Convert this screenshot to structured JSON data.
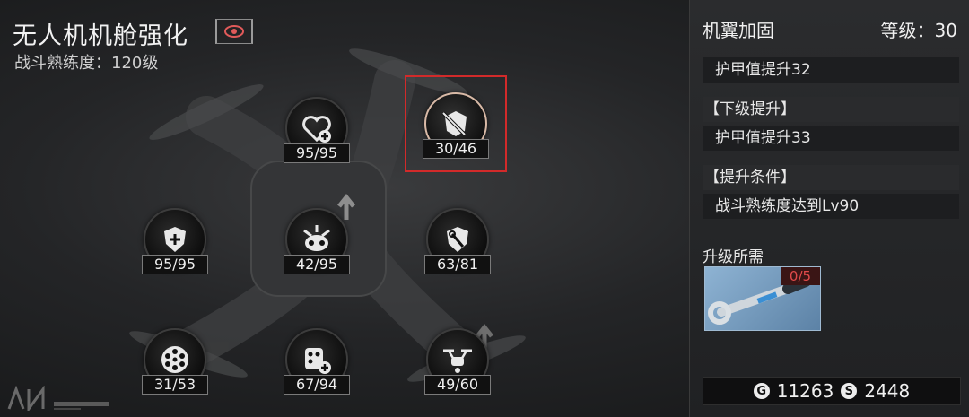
{
  "header": {
    "title": "无人机机舱强化",
    "subtitle": "战斗熟练度：120级"
  },
  "nodes": [
    {
      "name": "heart-plus",
      "count": "95/95"
    },
    {
      "name": "wrench-armor",
      "count": "30/46",
      "selected": true
    },
    {
      "name": "shield-plus",
      "count": "95/95"
    },
    {
      "name": "drone-core",
      "count": "42/95"
    },
    {
      "name": "shield-wrench",
      "count": "63/81"
    },
    {
      "name": "ammo-drum",
      "count": "31/53"
    },
    {
      "name": "magazine-plus",
      "count": "67/94"
    },
    {
      "name": "mini-drone",
      "count": "49/60"
    }
  ],
  "panel": {
    "title": "机翼加固",
    "level": "等级：30",
    "current_effect": "护甲值提升32",
    "next_header": "【下级提升】",
    "next_effect": "护甲值提升33",
    "cond_header": "【提升条件】",
    "cond_text": "战斗熟练度达到Lv90",
    "need_label": "升级所需",
    "item_count": "0/5",
    "currency_a": "11263",
    "currency_b": "2448",
    "currency_b_glyph": "S"
  },
  "colors": {
    "selection": "#d22a2a",
    "item_count_text": "#e04a4a",
    "eye_icon": "#e05a5a"
  }
}
